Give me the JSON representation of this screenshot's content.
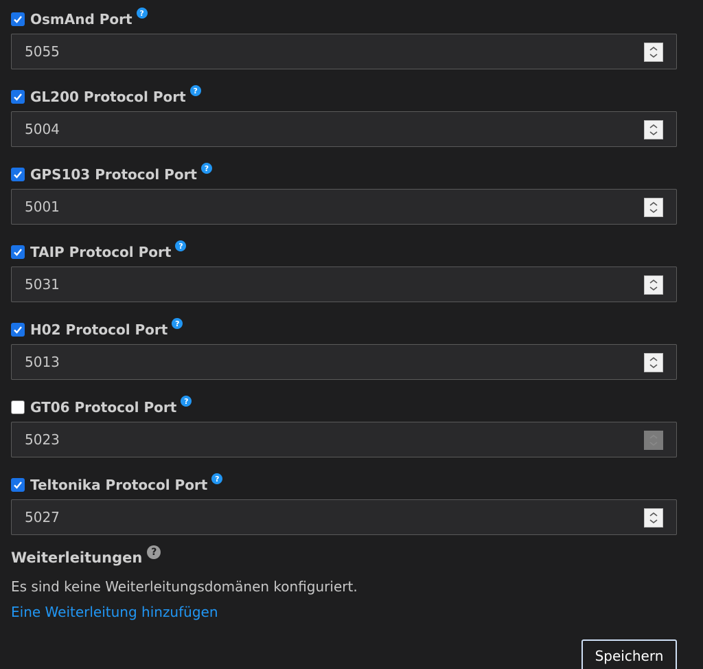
{
  "fields": [
    {
      "label": "OsmAnd Port",
      "value": "5055",
      "checked": true
    },
    {
      "label": "GL200 Protocol Port",
      "value": "5004",
      "checked": true
    },
    {
      "label": "GPS103 Protocol Port",
      "value": "5001",
      "checked": true
    },
    {
      "label": "TAIP Protocol Port",
      "value": "5031",
      "checked": true
    },
    {
      "label": "H02 Protocol Port",
      "value": "5013",
      "checked": true
    },
    {
      "label": "GT06 Protocol Port",
      "value": "5023",
      "checked": false
    },
    {
      "label": "Teltonika Protocol Port",
      "value": "5027",
      "checked": true
    }
  ],
  "forwarding": {
    "title": "Weiterleitungen",
    "empty_text": "Es sind keine Weiterleitungsdomänen konfiguriert.",
    "add_link": "Eine Weiterleitung hinzufügen"
  },
  "save_label": "Speichern",
  "help_symbol": "?",
  "colors": {
    "background": "#1e1e1f",
    "input_background": "#29292b",
    "accent": "#1a73e8",
    "link": "#2196f3",
    "help_icon": "#2196f3"
  }
}
